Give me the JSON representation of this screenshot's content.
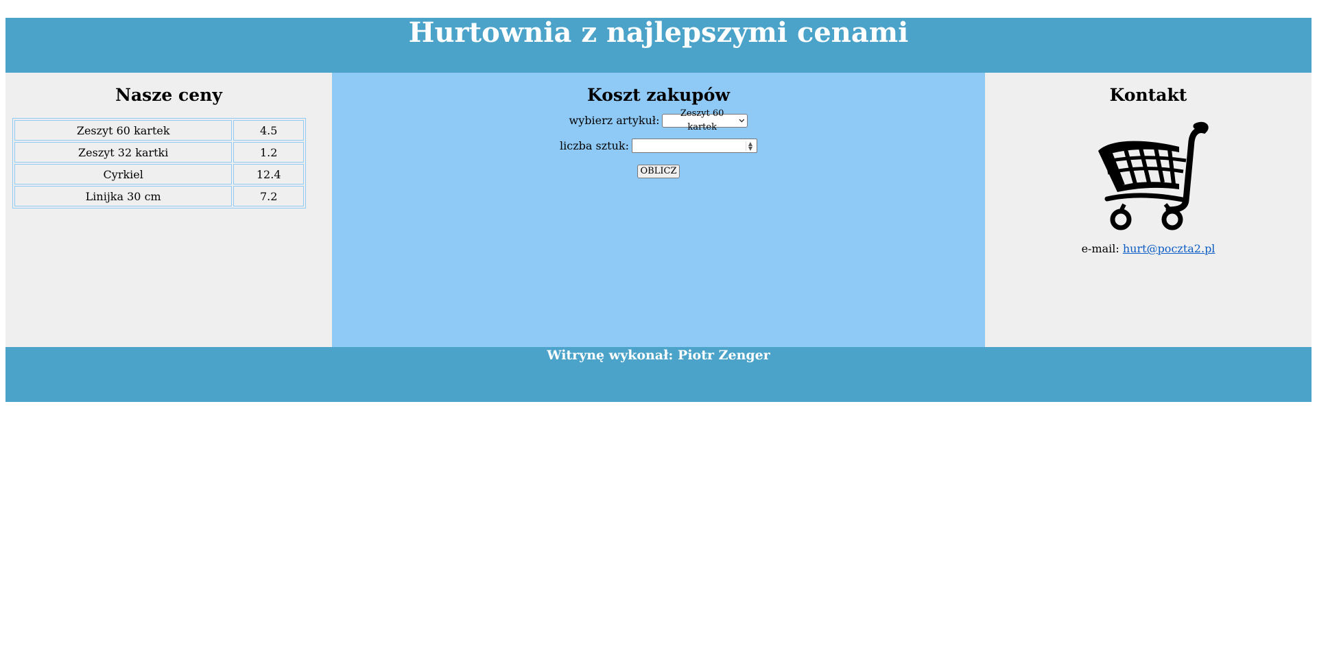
{
  "header": {
    "title": "Hurtownia z najlepszymi cenami"
  },
  "prices": {
    "heading": "Nasze ceny",
    "rows": [
      {
        "name": "Zeszyt 60 kartek",
        "price": "4.5"
      },
      {
        "name": "Zeszyt 32 kartki",
        "price": "1.2"
      },
      {
        "name": "Cyrkiel",
        "price": "12.4"
      },
      {
        "name": "Linijka 30 cm",
        "price": "7.2"
      }
    ]
  },
  "calc": {
    "heading": "Koszt zakupów",
    "article_label": "wybierz artykuł:",
    "article_selected": "Zeszyt 60 kartek",
    "qty_label": "liczba sztuk:",
    "qty_value": "",
    "button_label": "OBLICZ"
  },
  "contact": {
    "heading": "Kontakt",
    "email_label": "e-mail:",
    "email": "hurt@poczta2.pl",
    "image_icon": "shopping-cart-icon"
  },
  "footer": {
    "text": "Witrynę wykonał: Piotr Zenger"
  },
  "colors": {
    "banner": "#4ba3c9",
    "side_panels": "#efefef",
    "middle_panel": "#8fc9f6",
    "table_border": "#8fc9f6",
    "link": "#0b5cc4"
  }
}
